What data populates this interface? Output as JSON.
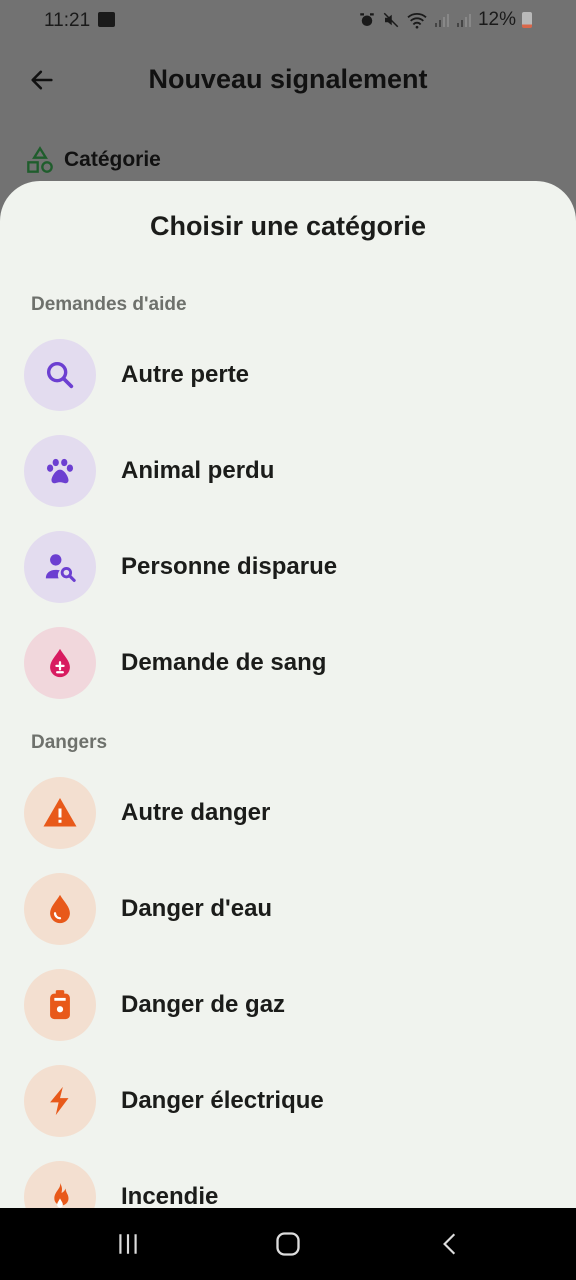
{
  "status_bar": {
    "time": "11:21",
    "battery": "12%"
  },
  "appbar": {
    "title": "Nouveau signalement"
  },
  "form": {
    "category_label": "Catégorie"
  },
  "sheet": {
    "title": "Choisir une catégorie",
    "sections": [
      {
        "header": "Demandes d'aide",
        "items": [
          {
            "label": "Autre perte",
            "icon": "search-icon",
            "color": "#6c3fd1",
            "bg": "#e3dcef"
          },
          {
            "label": "Animal perdu",
            "icon": "paw-icon",
            "color": "#6c3fd1",
            "bg": "#e3dcef"
          },
          {
            "label": "Personne disparue",
            "icon": "person-search-icon",
            "color": "#6c3fd1",
            "bg": "#e3dcef"
          },
          {
            "label": "Demande de sang",
            "icon": "blood-drop-icon",
            "color": "#d81b60",
            "bg": "#f1d7dc"
          }
        ]
      },
      {
        "header": "Dangers",
        "items": [
          {
            "label": "Autre danger",
            "icon": "warning-icon",
            "color": "#e8591a",
            "bg": "#f3dfd0"
          },
          {
            "label": "Danger d'eau",
            "icon": "water-drop-icon",
            "color": "#e8591a",
            "bg": "#f3dfd0"
          },
          {
            "label": "Danger de gaz",
            "icon": "gas-cylinder-icon",
            "color": "#e8591a",
            "bg": "#f3dfd0"
          },
          {
            "label": "Danger électrique",
            "icon": "lightning-icon",
            "color": "#e8591a",
            "bg": "#f3dfd0"
          },
          {
            "label": "Incendie",
            "icon": "fire-icon",
            "color": "#e8591a",
            "bg": "#f3dfd0"
          }
        ]
      }
    ]
  }
}
